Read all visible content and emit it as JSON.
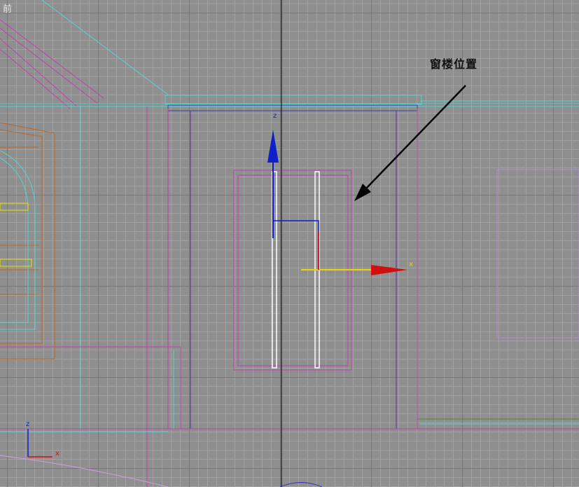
{
  "viewport": {
    "label": "前",
    "annotation": "窗楼位置"
  },
  "gizmo": {
    "z_label": "z",
    "x_label": "x",
    "z_color": "#1020c8",
    "x_color": "#d01010",
    "y_color": "#e8d800"
  },
  "view_axis": {
    "z_label": "z",
    "x_label": "x"
  },
  "colors": {
    "cyan": "#4fd6d6",
    "magenta": "#c23fb0",
    "purple": "#5a2da0",
    "orange": "#c0641c",
    "yellow": "#e8e000",
    "violet": "#b08be0"
  }
}
